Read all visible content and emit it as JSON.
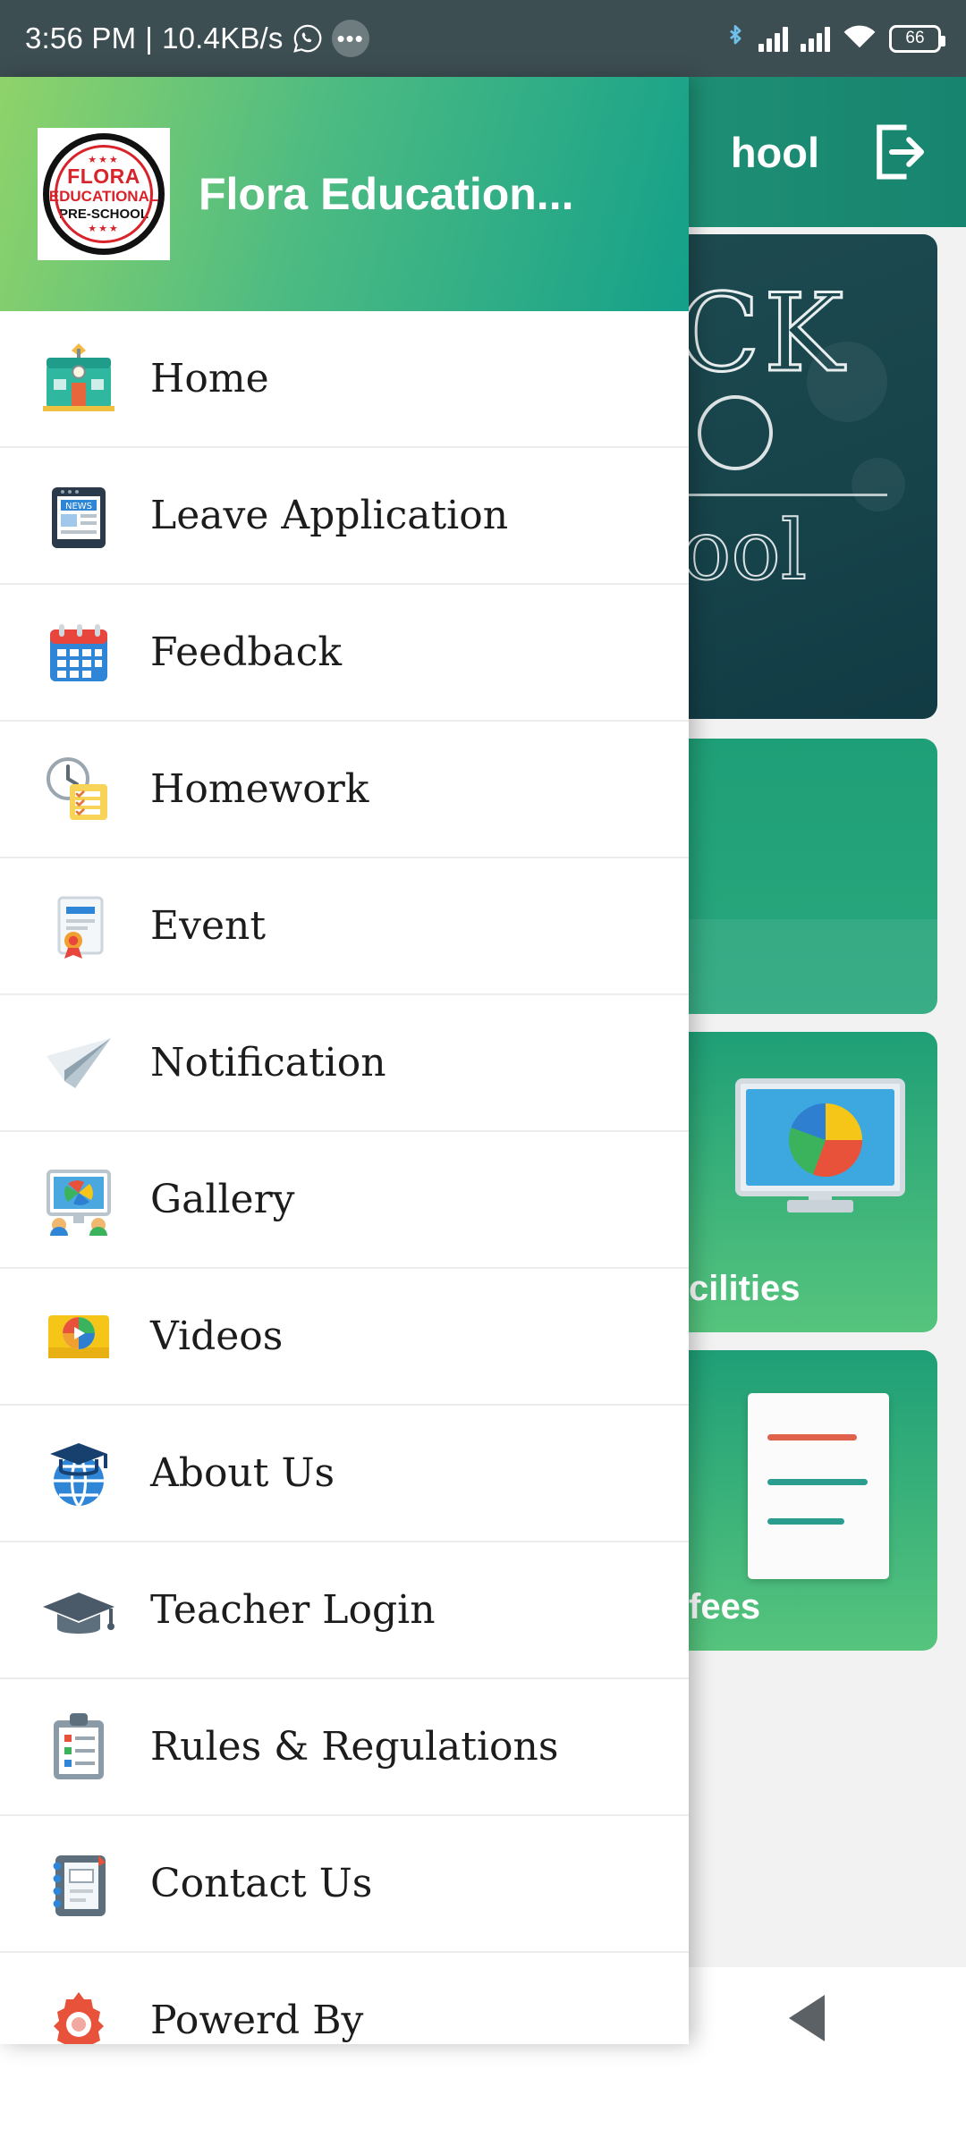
{
  "status_bar": {
    "time": "3:56 PM",
    "separator": "|",
    "network_speed": "10.4KB/s",
    "whatsapp_icon": "whatsapp-icon",
    "notification_dots": "•••",
    "bluetooth_icon": "bluetooth-icon",
    "signal_icon_1": "signal-bars-icon",
    "signal_icon_2": "signal-bars-icon",
    "wifi_icon": "wifi-icon",
    "battery_level": "66"
  },
  "app_bar": {
    "title_visible": "hool",
    "logout_icon": "logout-icon"
  },
  "background_tiles": [
    {
      "name": "banner",
      "chalk_text_1": "CK",
      "chalk_text_2": "ool"
    },
    {
      "name": "green-tile",
      "label": ""
    },
    {
      "name": "facilities-tile",
      "label": "cilities"
    },
    {
      "name": "fees-tile",
      "label": "fees"
    }
  ],
  "drawer": {
    "logo": {
      "line1": "FLORA",
      "line2": "EDUCATIONAL",
      "line3": "PRE-SCHOOL",
      "stars": "★★★"
    },
    "title": "Flora Education...",
    "items": [
      {
        "label": "Home",
        "icon": "school-building-icon"
      },
      {
        "label": "Leave Application",
        "icon": "news-tablet-icon"
      },
      {
        "label": "Feedback",
        "icon": "calendar-icon"
      },
      {
        "label": "Homework",
        "icon": "clock-checklist-icon"
      },
      {
        "label": "Event",
        "icon": "certificate-icon"
      },
      {
        "label": "Notification",
        "icon": "paper-plane-icon"
      },
      {
        "label": "Gallery",
        "icon": "presentation-board-icon"
      },
      {
        "label": "Videos",
        "icon": "video-play-icon"
      },
      {
        "label": "About Us",
        "icon": "graduation-globe-icon"
      },
      {
        "label": "Teacher Login",
        "icon": "graduation-cap-icon"
      },
      {
        "label": "Rules & Regulations",
        "icon": "clipboard-list-icon"
      },
      {
        "label": "Contact Us",
        "icon": "notebook-icon"
      },
      {
        "label": "Powerd By",
        "icon": "gear-icon"
      }
    ]
  },
  "navigation_bar": {
    "recents": "square-icon",
    "home": "circle-icon",
    "back": "triangle-back-icon"
  }
}
